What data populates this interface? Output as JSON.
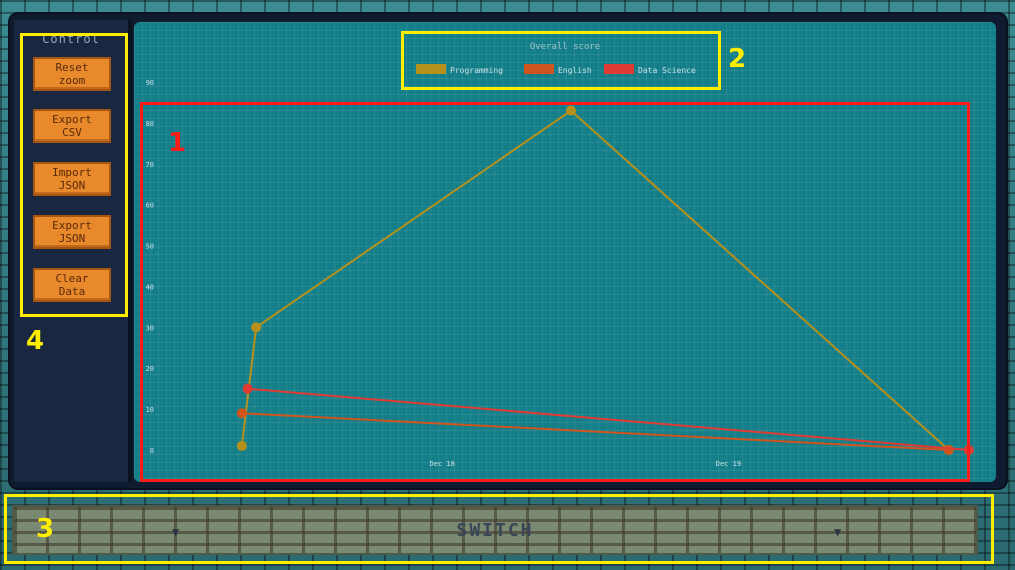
{
  "sidebar": {
    "title": "Control",
    "buttons": [
      {
        "label": "Reset\nzoom"
      },
      {
        "label": "Export\nCSV"
      },
      {
        "label": "Import\nJSON"
      },
      {
        "label": "Export\nJSON"
      },
      {
        "label": "Clear\nData"
      }
    ]
  },
  "switch_bar": {
    "label": "SWITCH"
  },
  "annotations": {
    "chart_area": "1",
    "legend": "2",
    "switch": "3",
    "controls": "4"
  },
  "colors": {
    "programming": "#b5901a",
    "english": "#d0541e",
    "data_science": "#e03a32",
    "annotation_red": "#ff1a1a",
    "annotation_yellow": "#ffee00",
    "button_orange": "#e8892c"
  },
  "chart_data": {
    "type": "line",
    "title": "Overall score",
    "ylim": [
      0,
      90
    ],
    "yticks": [
      "0",
      "10",
      "20",
      "30",
      "40",
      "50",
      "60",
      "70",
      "80",
      "90"
    ],
    "xticks": [
      "Dec 18",
      "Dec 19"
    ],
    "legend_position": "top-center",
    "grid": true,
    "series": [
      {
        "name": "Programming",
        "color": "#b5901a",
        "points": [
          [
            -0.7,
            1
          ],
          [
            -0.65,
            30
          ],
          [
            0.45,
            83
          ],
          [
            1.77,
            0
          ]
        ]
      },
      {
        "name": "English",
        "color": "#d0541e",
        "points": [
          [
            -0.7,
            9
          ],
          [
            1.77,
            0
          ]
        ]
      },
      {
        "name": "Data Science",
        "color": "#e03a32",
        "points": [
          [
            -0.68,
            15
          ],
          [
            1.84,
            0
          ]
        ]
      }
    ]
  }
}
